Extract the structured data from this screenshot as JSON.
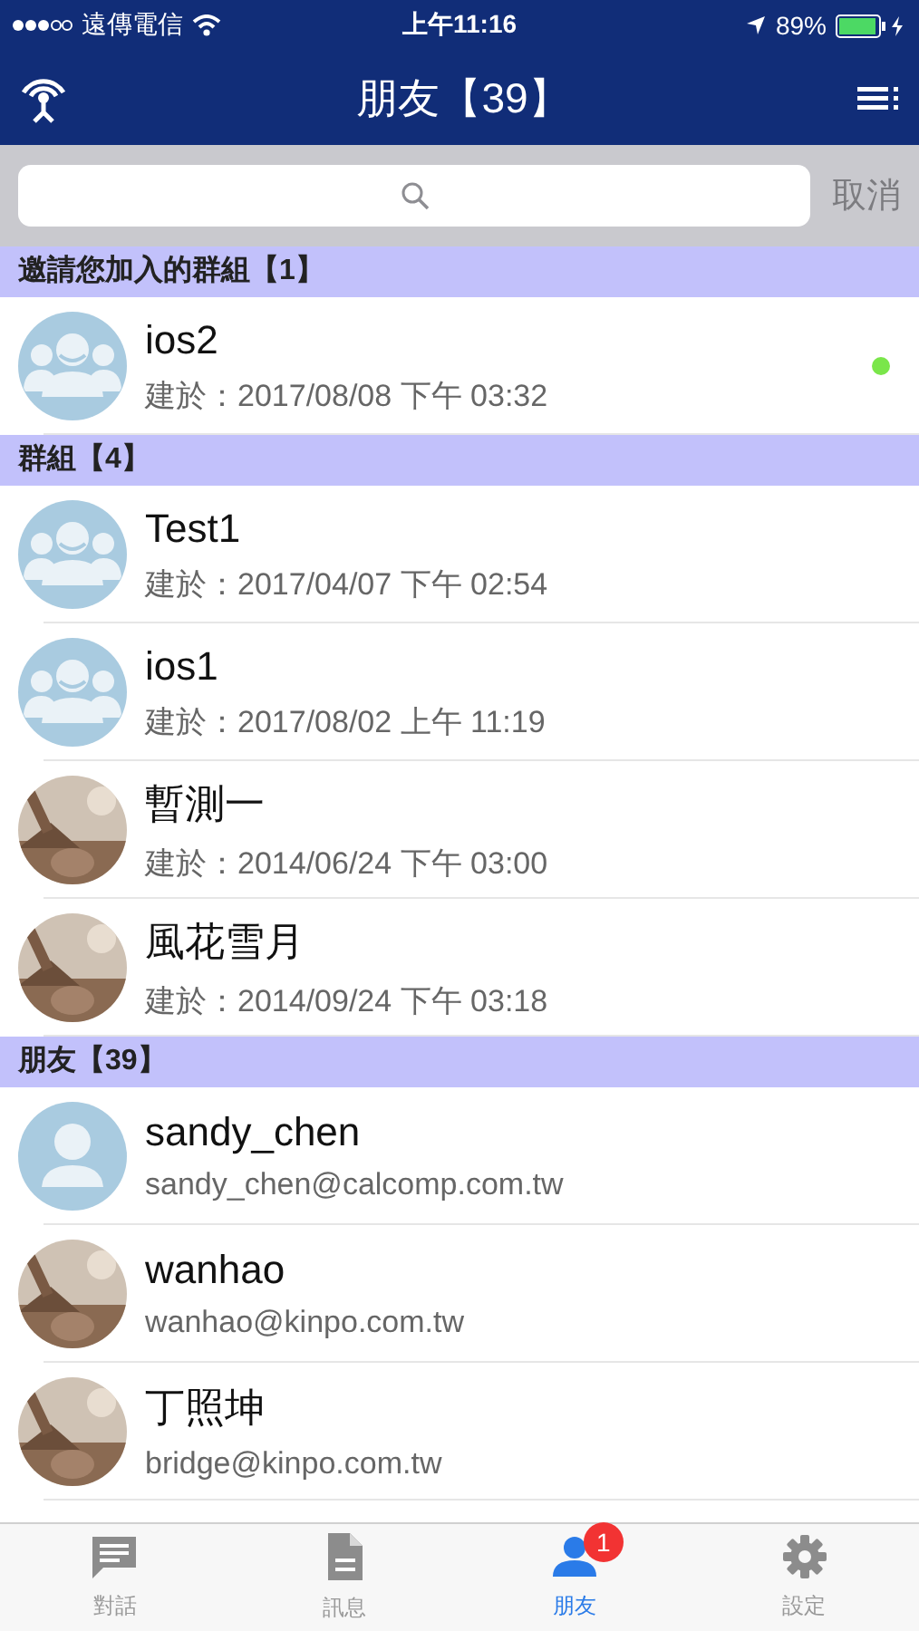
{
  "status_bar": {
    "carrier": "遠傳電信",
    "time": "上午11:16",
    "battery": "89%"
  },
  "nav_bar": {
    "title": "朋友【39】"
  },
  "search": {
    "cancel": "取消"
  },
  "sections": [
    {
      "title": "邀請您加入的群組【1】",
      "items": [
        {
          "kind": "group",
          "name": "ios2",
          "subtitle": "建於：2017/08/08 下午 03:32",
          "online": true
        }
      ]
    },
    {
      "title": "群組【4】",
      "items": [
        {
          "kind": "group",
          "name": "Test1",
          "subtitle": "建於：2017/04/07 下午 02:54",
          "online": false
        },
        {
          "kind": "group",
          "name": "ios1",
          "subtitle": "建於：2017/08/02 上午 11:19",
          "online": false
        },
        {
          "kind": "picture",
          "name": "暫測一",
          "subtitle": "建於：2014/06/24 下午 03:00",
          "online": false
        },
        {
          "kind": "picture",
          "name": "風花雪月",
          "subtitle": "建於：2014/09/24 下午 03:18",
          "online": false
        }
      ]
    },
    {
      "title": "朋友【39】",
      "items": [
        {
          "kind": "person",
          "name": "sandy_chen",
          "subtitle": "sandy_chen@calcomp.com.tw",
          "online": false
        },
        {
          "kind": "picture",
          "name": "wanhao",
          "subtitle": "wanhao@kinpo.com.tw",
          "online": false
        },
        {
          "kind": "picture",
          "name": "丁照坤",
          "subtitle": "bridge@kinpo.com.tw",
          "online": false
        }
      ]
    }
  ],
  "tabs": [
    {
      "kind": "chat",
      "label": "對話",
      "selected": false
    },
    {
      "kind": "document",
      "label": "訊息",
      "selected": false
    },
    {
      "kind": "friends",
      "label": "朋友",
      "selected": true,
      "badge": "1"
    },
    {
      "kind": "settings",
      "label": "設定",
      "selected": false
    }
  ]
}
